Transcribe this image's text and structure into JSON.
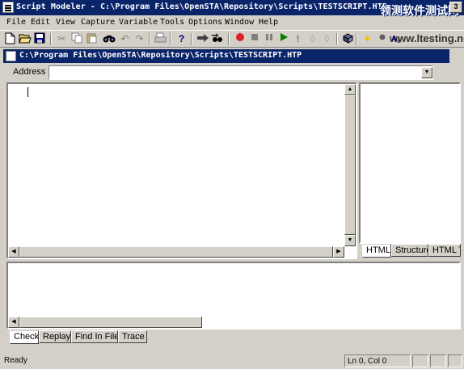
{
  "window": {
    "title": "Script Modeler - C:\\Program Files\\OpenSTA\\Repository\\Scripts\\TESTSCRIPT.HTP",
    "watermark_cn": "领测软件测试网",
    "watermark_url": "www.ltesting.net"
  },
  "menu": [
    "File",
    "Edit",
    "View",
    "Capture",
    "Variable",
    "Tools",
    "Options",
    "Window",
    "Help"
  ],
  "toolbar": {
    "icons": [
      "new-icon",
      "open-icon",
      "save-icon",
      "cut-icon",
      "copy-icon",
      "paste-icon",
      "find-icon",
      "undo-icon",
      "redo-icon",
      "print-icon",
      "help-icon",
      "goto-icon",
      "find-next-icon",
      "record-icon",
      "stop-icon",
      "pause-icon",
      "play-icon",
      "exclamation-icon",
      "step-icon",
      "step2-icon",
      "compile-icon",
      "highlight-icon",
      "dot-icon",
      "replace-icon"
    ]
  },
  "document": {
    "path": "C:\\Program Files\\OpenSTA\\Repository\\Scripts\\TESTSCRIPT.HTP"
  },
  "address": {
    "label": "Address",
    "value": ""
  },
  "right_tabs": [
    "HTML",
    "Structure",
    "HTML T"
  ],
  "output_tabs": [
    "Check",
    "Replay",
    "Find In Files",
    "Trace"
  ],
  "status": {
    "left": "Ready",
    "position": "Ln 0, Col 0"
  },
  "colors": {
    "titlebar": "#0a246a",
    "face": "#d4d0c8",
    "record": "#e02020",
    "play": "#008000"
  }
}
